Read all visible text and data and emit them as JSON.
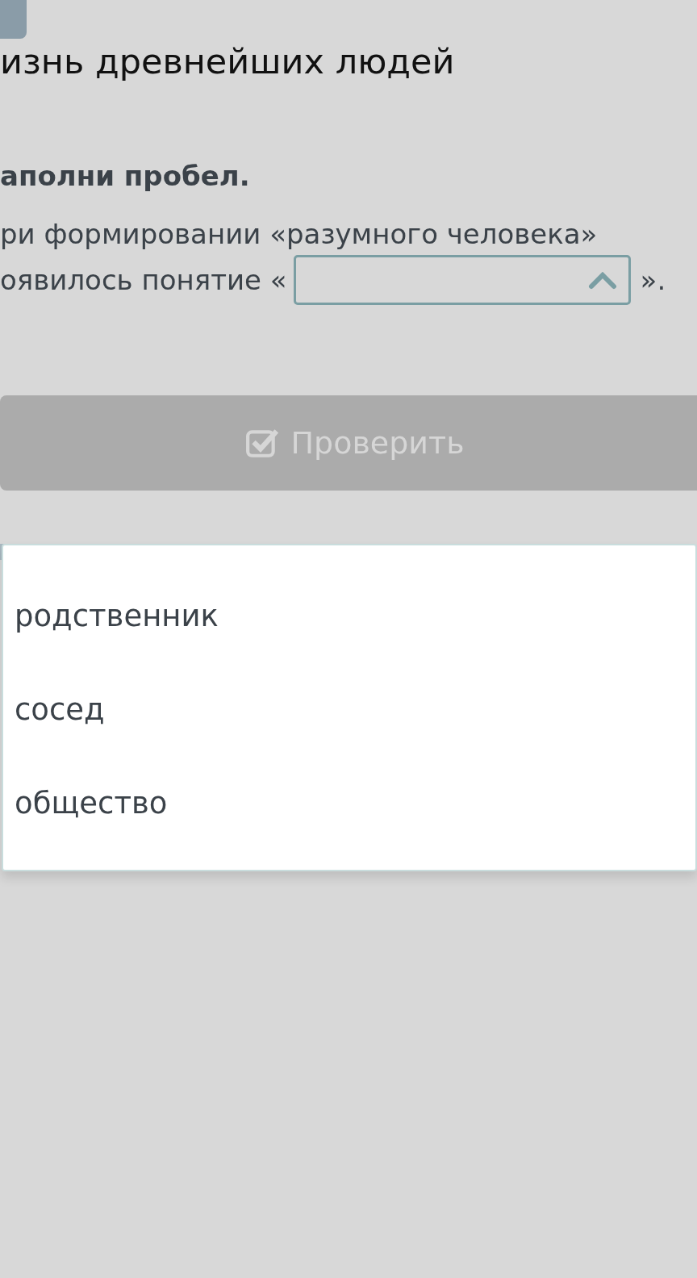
{
  "title": "изнь древнейших людей",
  "task": {
    "heading": "аполни пробел.",
    "line_1": "ри формировании «разумного человека»",
    "line_2_before": "оявилось понятие «",
    "line_2_after": "».",
    "blank": {
      "expanded": true
    }
  },
  "check_button": {
    "label": "Проверить",
    "disabled": true
  },
  "dropdown": {
    "options": [
      "родственник",
      "сосед",
      "общество"
    ]
  }
}
